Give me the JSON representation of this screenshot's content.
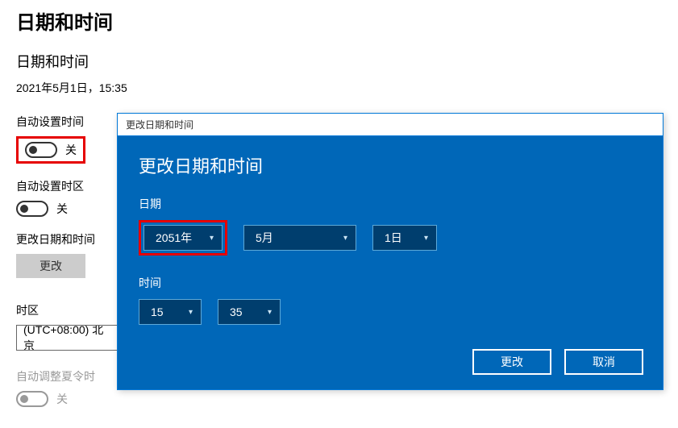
{
  "page": {
    "title": "日期和时间",
    "section_title": "日期和时间",
    "current_datetime": "2021年5月1日，15:35"
  },
  "settings": {
    "auto_time": {
      "label": "自动设置时间",
      "state": "关"
    },
    "auto_tz": {
      "label": "自动设置时区",
      "state": "关"
    },
    "change_dt": {
      "label": "更改日期和时间",
      "button": "更改"
    },
    "tz": {
      "label": "时区",
      "value": "(UTC+08:00) 北京"
    },
    "dst": {
      "label": "自动调整夏令时",
      "state": "关"
    }
  },
  "dialog": {
    "titlebar": "更改日期和时间",
    "heading": "更改日期和时间",
    "date_label": "日期",
    "time_label": "时间",
    "date": {
      "year": "2051年",
      "month": "5月",
      "day": "1日"
    },
    "time": {
      "hour": "15",
      "minute": "35"
    },
    "buttons": {
      "change": "更改",
      "cancel": "取消"
    }
  }
}
